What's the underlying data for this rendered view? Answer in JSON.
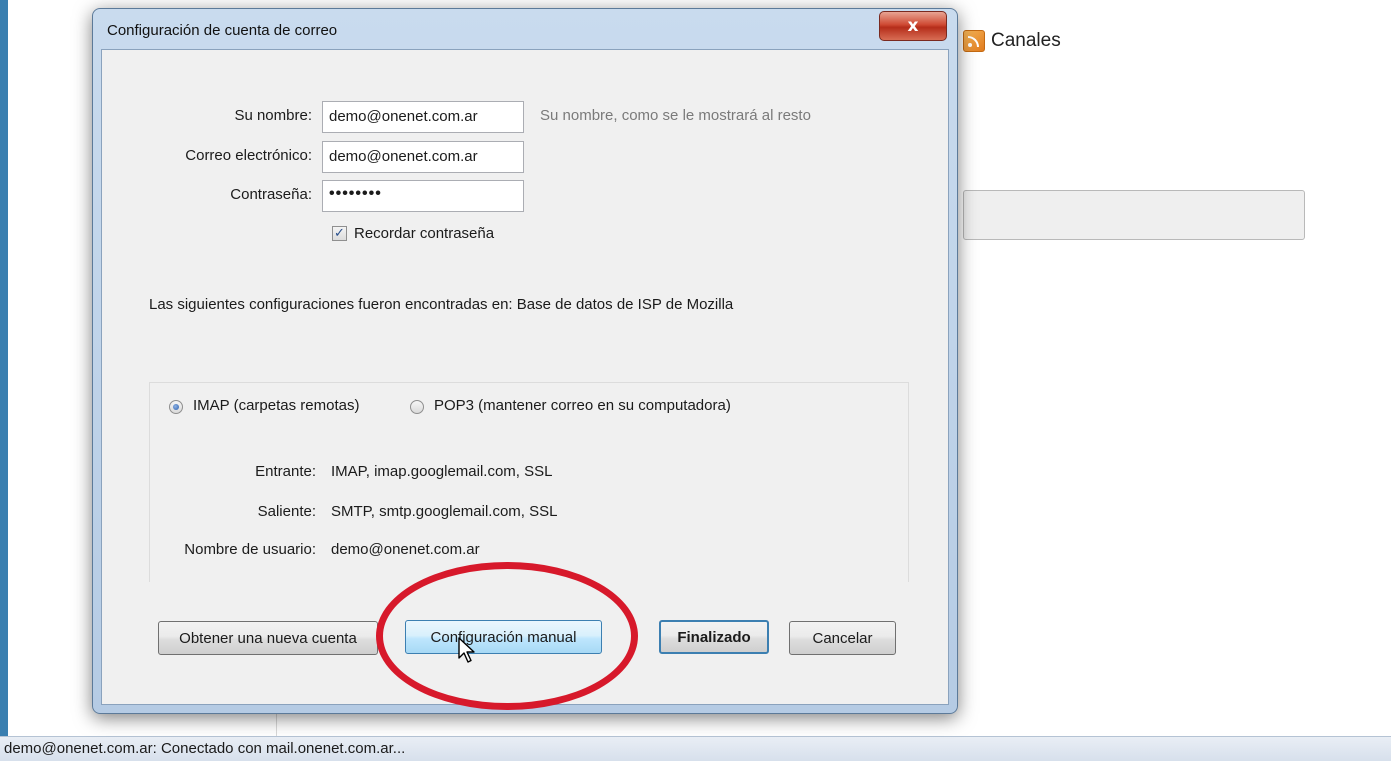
{
  "background": {
    "channels_label": "Canales",
    "channels_icon": "rss-icon"
  },
  "statusbar": {
    "text": "demo@onenet.com.ar: Conectado con mail.onenet.com.ar..."
  },
  "dialog": {
    "title": "Configuración de cuenta de correo",
    "close_glyph": "x",
    "name_label": "Su nombre:",
    "name_value": "demo@onenet.com.ar",
    "name_hint": "Su nombre, como se le mostrará al resto",
    "email_label": "Correo electrónico:",
    "email_value": "demo@onenet.com.ar",
    "password_label": "Contraseña:",
    "password_value": "••••••••",
    "remember_label": "Recordar contraseña",
    "remember_checked": true,
    "found_text": "Las siguientes configuraciones fueron encontradas en: Base de datos de ISP de Mozilla",
    "imap_label": "IMAP (carpetas remotas)",
    "pop3_label": "POP3 (mantener correo en su computadora)",
    "incoming_label": "Entrante:",
    "incoming_value": "IMAP, imap.googlemail.com, SSL",
    "outgoing_label": "Saliente:",
    "outgoing_value": "SMTP, smtp.googlemail.com, SSL",
    "username_label": "Nombre de usuario:",
    "username_value": "demo@onenet.com.ar",
    "btn_new_account": "Obtener una nueva cuenta",
    "btn_manual": "Configuración manual",
    "btn_done": "Finalizado",
    "btn_cancel": "Cancelar"
  },
  "colors": {
    "highlight_ring": "#d7192b",
    "desktop": "#3a7fb0"
  }
}
